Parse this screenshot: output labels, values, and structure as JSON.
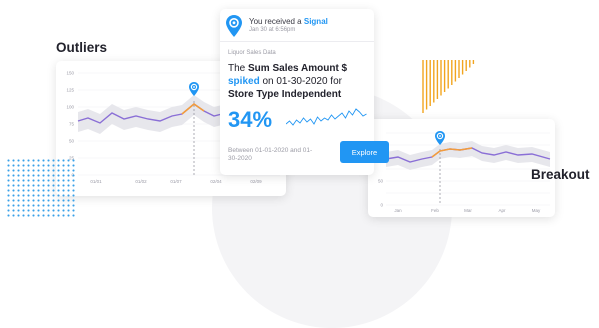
{
  "colors": {
    "accent": "#2196f3",
    "series_purple": "#8a6fd6",
    "series_orange": "#f39c3c",
    "band": "#e4e4ea",
    "stripes": "#f2a51f",
    "dots": "#3aa0e8"
  },
  "outliers": {
    "title": "Outliers",
    "y_ticks": [
      "150",
      "125",
      "100",
      "75",
      "50",
      "25",
      "0"
    ],
    "x_ticks": [
      "01/01",
      "01/02",
      "01/07",
      "02/04",
      "02/09"
    ],
    "marker_icon": "location-pin-icon"
  },
  "breakout": {
    "title": "Breakout",
    "y_ticks": [
      "50",
      "0"
    ],
    "x_ticks": [
      "Jan",
      "Feb",
      "Mar",
      "Apr",
      "May"
    ],
    "marker_icon": "location-pin-icon"
  },
  "signal": {
    "icon": "location-pin-icon",
    "title_prefix": "You received a ",
    "title_highlight": "Signal",
    "timestamp": "Jan 30 at 6:56pm",
    "source": "Liquor Sales Data",
    "body_1": "The ",
    "metric": "Sum Sales Amount $",
    "body_2": " ",
    "verb": "spiked",
    "body_3": " on 01-30-2020 for ",
    "dimension": "Store Type Independent",
    "change_percent": "34%",
    "between": "Between 01-01-2020 and 01-30-2020",
    "explore_label": "Explore"
  }
}
